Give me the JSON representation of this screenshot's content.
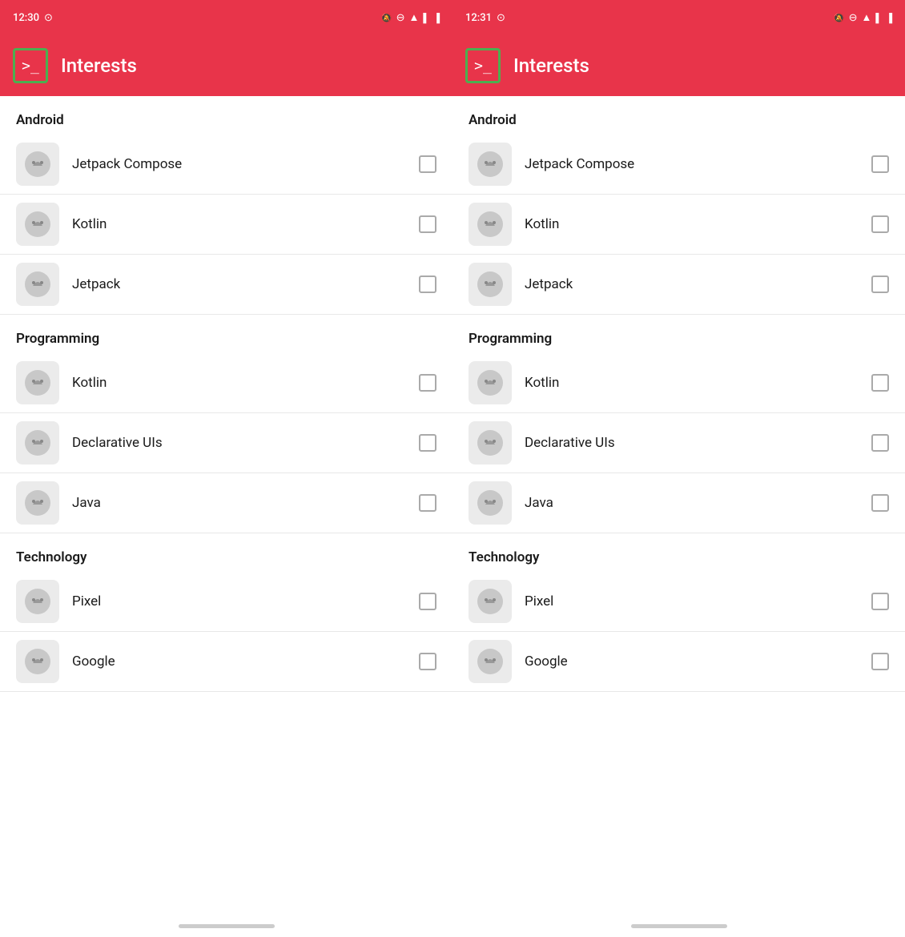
{
  "screens": [
    {
      "id": "screen-left",
      "status_bar": {
        "time": "12:30",
        "icons_left": [
          "clock-icon"
        ],
        "icons_right": [
          "bell-mute-icon",
          "minus-circle-icon",
          "wifi-icon",
          "signal-icon",
          "battery-icon"
        ]
      },
      "app_bar": {
        "title": "Interests",
        "icon_label": ">_"
      },
      "sections": [
        {
          "header": "Android",
          "items": [
            {
              "label": "Jetpack Compose"
            },
            {
              "label": "Kotlin"
            },
            {
              "label": "Jetpack"
            }
          ]
        },
        {
          "header": "Programming",
          "items": [
            {
              "label": "Kotlin"
            },
            {
              "label": "Declarative UIs"
            },
            {
              "label": "Java"
            }
          ]
        },
        {
          "header": "Technology",
          "items": [
            {
              "label": "Pixel"
            },
            {
              "label": "Google"
            }
          ]
        }
      ]
    },
    {
      "id": "screen-right",
      "status_bar": {
        "time": "12:31",
        "icons_left": [
          "clock-icon"
        ],
        "icons_right": [
          "bell-mute-icon",
          "minus-circle-icon",
          "wifi-icon",
          "signal-icon",
          "battery-icon"
        ]
      },
      "app_bar": {
        "title": "Interests",
        "icon_label": ">_"
      },
      "sections": [
        {
          "header": "Android",
          "items": [
            {
              "label": "Jetpack Compose"
            },
            {
              "label": "Kotlin"
            },
            {
              "label": "Jetpack"
            }
          ]
        },
        {
          "header": "Programming",
          "items": [
            {
              "label": "Kotlin"
            },
            {
              "label": "Declarative UIs"
            },
            {
              "label": "Java"
            }
          ]
        },
        {
          "header": "Technology",
          "items": [
            {
              "label": "Pixel"
            },
            {
              "label": "Google"
            }
          ]
        }
      ]
    }
  ],
  "colors": {
    "accent": "#e8344a",
    "green_border": "#4caf50",
    "section_bg": "#fff",
    "item_icon_bg": "#ebebeb"
  }
}
